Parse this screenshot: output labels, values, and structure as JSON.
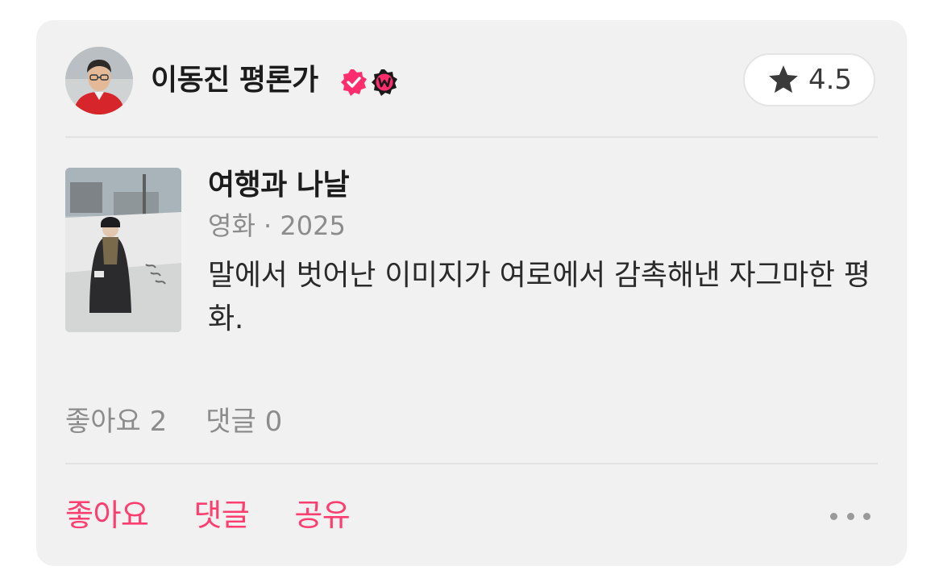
{
  "author": {
    "name": "이동진 평론가",
    "avatar_icon": "person-photo",
    "badges": [
      {
        "icon": "verified-badge-icon",
        "color": "#ff2d6e"
      },
      {
        "icon": "watcha-w-badge-icon",
        "color": "#1a1a1a"
      }
    ]
  },
  "rating": {
    "icon": "star-icon",
    "value": "4.5"
  },
  "content": {
    "title": "여행과 나날",
    "meta": "영화 · 2025",
    "poster_icon": "movie-poster"
  },
  "review": {
    "text": "말에서 벗어난 이미지가 여로에서 감촉해낸 자그마한 평화."
  },
  "stats": {
    "likes_label": "좋아요 2",
    "comments_label": "댓글 0"
  },
  "actions": {
    "like_label": "좋아요",
    "comment_label": "댓글",
    "share_label": "공유",
    "more_icon": "more-dots-icon"
  },
  "colors": {
    "accent": "#ff3d6e",
    "card_background": "#f1f1f1",
    "secondary_text": "#8c8c8c"
  }
}
